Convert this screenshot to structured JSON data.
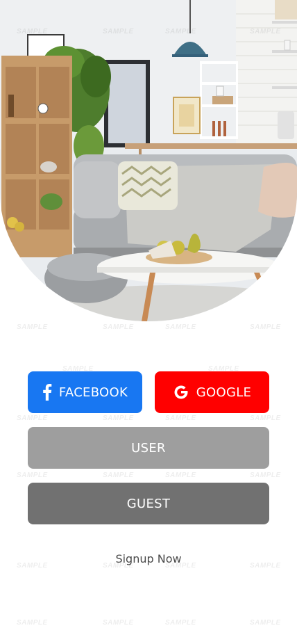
{
  "buttons": {
    "facebook_label": "FACEBOOK",
    "google_label": "GOOGLE",
    "user_label": "USER",
    "guest_label": "GUEST"
  },
  "signup_label": "Signup Now",
  "watermark_text": "SAMPLE",
  "colors": {
    "facebook": "#1877f2",
    "google": "#ff0000",
    "user": "#9e9e9e",
    "guest": "#717171"
  },
  "icons": {
    "facebook": "facebook-icon",
    "google": "google-icon"
  }
}
